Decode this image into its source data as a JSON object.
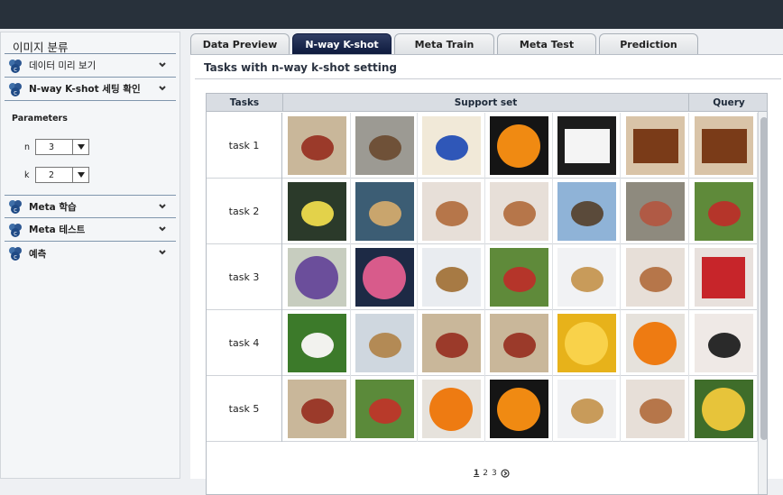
{
  "sidebar": {
    "title": "이미지 분류",
    "items_top": [
      {
        "label": "데이터 미리 보기"
      },
      {
        "label": "N-way K-shot 세팅 확인"
      }
    ],
    "params_heading": "Parameters",
    "params": [
      {
        "name": "n",
        "value": "3"
      },
      {
        "name": "k",
        "value": "2"
      }
    ],
    "items_bottom": [
      {
        "label": "Meta 학습"
      },
      {
        "label": "Meta 테스트"
      },
      {
        "label": "예측"
      }
    ]
  },
  "tabs": [
    {
      "label": "Data Preview"
    },
    {
      "label": "N-way K-shot"
    },
    {
      "label": "Meta Train"
    },
    {
      "label": "Meta Test"
    },
    {
      "label": "Prediction"
    }
  ],
  "active_tab": "N-way K-shot",
  "panel": {
    "title": "Tasks with n-way k-shot setting",
    "columns": {
      "tasks": "Tasks",
      "support": "Support set",
      "query": "Query"
    },
    "rows": [
      {
        "task": "task 1",
        "images": [
          "bird-on-branch",
          "brown-bird",
          "fruit-bowl",
          "orange",
          "piano-keys",
          "upright-piano",
          "upright-piano"
        ]
      },
      {
        "task": "task 2",
        "images": [
          "tropical-fish",
          "birds-at-feeder",
          "puppy",
          "puppy",
          "birds-on-branch",
          "fence",
          "red-bird"
        ]
      },
      {
        "task": "task 3",
        "images": [
          "purple-doily",
          "pink-doily",
          "small-bird",
          "red-bird",
          "puppies",
          "puppy",
          "red-knit"
        ]
      },
      {
        "task": "task 4",
        "images": [
          "white-dog",
          "puppy-in-basket",
          "bird-on-branch",
          "bird-on-branch",
          "orange-slice",
          "orange-slices",
          "black-poodle"
        ]
      },
      {
        "task": "task 5",
        "images": [
          "bird-on-branch",
          "bird-on-birdhouse",
          "orange-slices",
          "orange",
          "puppies",
          "puppy",
          "lemon-tree"
        ]
      }
    ]
  },
  "pager": {
    "pages": [
      "1",
      "2",
      "3"
    ],
    "current": "1",
    "next_icon": "next-circle-icon"
  }
}
